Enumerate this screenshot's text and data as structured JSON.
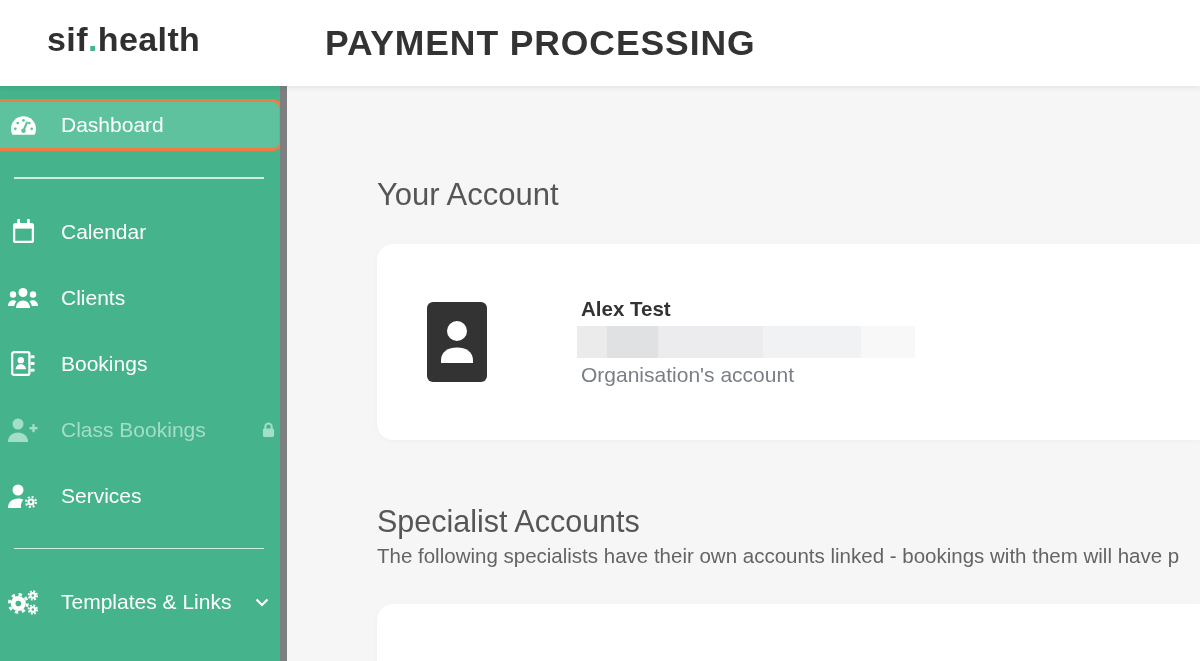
{
  "header": {
    "logo": [
      "sif",
      ".",
      "health"
    ],
    "title": "PAYMENT PROCESSING"
  },
  "sidebar": {
    "sections": [
      {
        "items": [
          {
            "label": "Dashboard",
            "kind": "link",
            "selected": true,
            "disabled": false,
            "locked": false
          }
        ]
      },
      {
        "items": [
          {
            "label": "Calendar",
            "kind": "link",
            "selected": false,
            "disabled": false,
            "locked": false
          },
          {
            "label": "Clients",
            "kind": "link",
            "selected": false,
            "disabled": false,
            "locked": false
          },
          {
            "label": "Bookings",
            "kind": "link",
            "selected": false,
            "disabled": false,
            "locked": false
          },
          {
            "label": "Class Bookings",
            "kind": "link",
            "selected": false,
            "disabled": true,
            "locked": true
          },
          {
            "label": "Services",
            "kind": "link",
            "selected": false,
            "disabled": false,
            "locked": false
          }
        ]
      },
      {
        "items": [
          {
            "label": "Templates & Links",
            "kind": "group",
            "selected": false,
            "disabled": false,
            "locked": false,
            "expanded": false
          }
        ]
      }
    ]
  },
  "your_account": {
    "title": "Your Account",
    "card": {
      "name": "Alex Test",
      "email_redacted": true,
      "role": "Organisation's account"
    }
  },
  "specialist_accounts": {
    "title": "Specialist Accounts",
    "description": "The following specialists have their own accounts linked - bookings with them will have p"
  }
}
